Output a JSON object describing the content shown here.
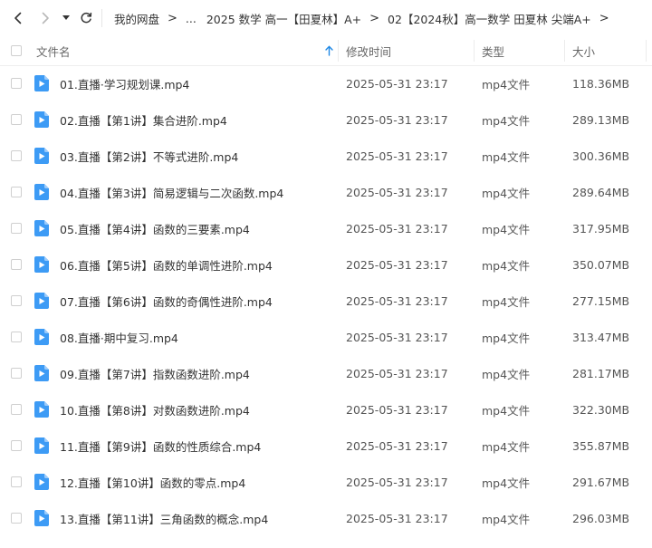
{
  "breadcrumb": {
    "items": [
      "我的网盘",
      "...",
      "2025 数学 高一【田夏林】A+",
      "02【2024秋】高一数学 田夏林 尖端A+"
    ],
    "separator": ">"
  },
  "header": {
    "name": "文件名",
    "modified": "修改时间",
    "type": "类型",
    "size": "大小"
  },
  "colors": {
    "accent": "#1e88e5",
    "file_icon": "#3d9bf5"
  },
  "files": [
    {
      "name": "01.直播·学习规划课.mp4",
      "modified": "2025-05-31 23:17",
      "type": "mp4文件",
      "size": "118.36MB"
    },
    {
      "name": "02.直播【第1讲】集合进阶.mp4",
      "modified": "2025-05-31 23:17",
      "type": "mp4文件",
      "size": "289.13MB"
    },
    {
      "name": "03.直播【第2讲】不等式进阶.mp4",
      "modified": "2025-05-31 23:17",
      "type": "mp4文件",
      "size": "300.36MB"
    },
    {
      "name": "04.直播【第3讲】简易逻辑与二次函数.mp4",
      "modified": "2025-05-31 23:17",
      "type": "mp4文件",
      "size": "289.64MB"
    },
    {
      "name": "05.直播【第4讲】函数的三要素.mp4",
      "modified": "2025-05-31 23:17",
      "type": "mp4文件",
      "size": "317.95MB"
    },
    {
      "name": "06.直播【第5讲】函数的单调性进阶.mp4",
      "modified": "2025-05-31 23:17",
      "type": "mp4文件",
      "size": "350.07MB"
    },
    {
      "name": "07.直播【第6讲】函数的奇偶性进阶.mp4",
      "modified": "2025-05-31 23:17",
      "type": "mp4文件",
      "size": "277.15MB"
    },
    {
      "name": "08.直播·期中复习.mp4",
      "modified": "2025-05-31 23:17",
      "type": "mp4文件",
      "size": "313.47MB"
    },
    {
      "name": "09.直播【第7讲】指数函数进阶.mp4",
      "modified": "2025-05-31 23:17",
      "type": "mp4文件",
      "size": "281.17MB"
    },
    {
      "name": "10.直播【第8讲】对数函数进阶.mp4",
      "modified": "2025-05-31 23:17",
      "type": "mp4文件",
      "size": "322.30MB"
    },
    {
      "name": "11.直播【第9讲】函数的性质综合.mp4",
      "modified": "2025-05-31 23:17",
      "type": "mp4文件",
      "size": "355.87MB"
    },
    {
      "name": "12.直播【第10讲】函数的零点.mp4",
      "modified": "2025-05-31 23:17",
      "type": "mp4文件",
      "size": "291.67MB"
    },
    {
      "name": "13.直播【第11讲】三角函数的概念.mp4",
      "modified": "2025-05-31 23:17",
      "type": "mp4文件",
      "size": "296.03MB"
    }
  ]
}
